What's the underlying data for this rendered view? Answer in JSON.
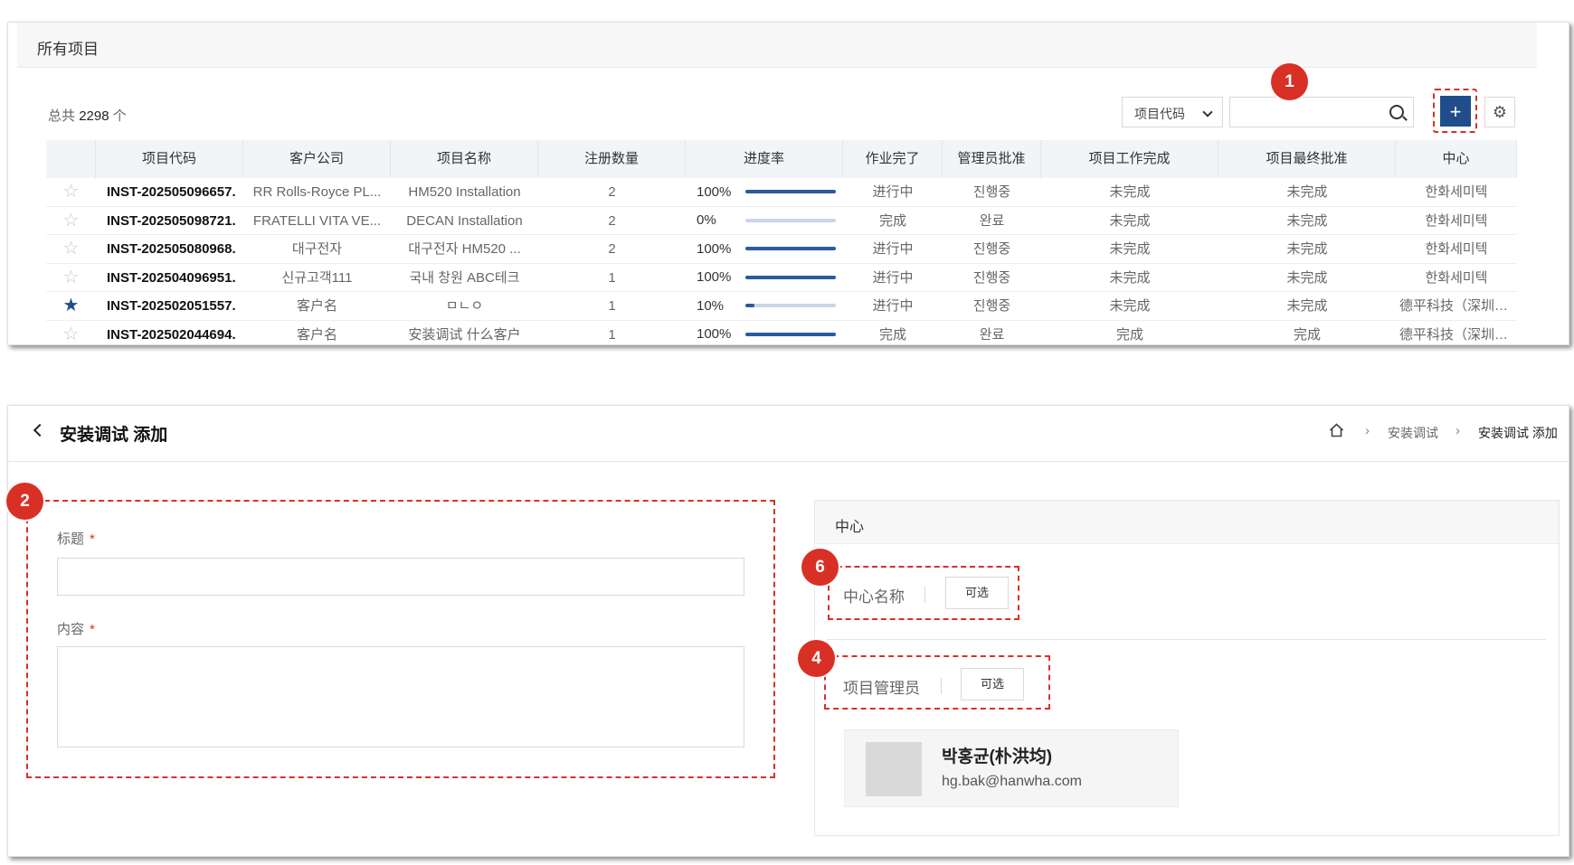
{
  "all_projects": {
    "title": "所有项目",
    "total_prefix": "总共",
    "total_count": "2298",
    "total_suffix": "个",
    "filter_value": "项目代码",
    "search_value": "",
    "add_label": "+",
    "columns": [
      "",
      "项目代码",
      "客户公司",
      "项目名称",
      "注册数量",
      "进度率",
      "作业完了",
      "管理员批准",
      "项目工作完成",
      "项目最终批准",
      "中心"
    ],
    "rows": [
      {
        "starred": false,
        "code": "INST-202505096657.",
        "client": "RR Rolls-Royce PL...",
        "name": "HM520 Installation",
        "qty": "2",
        "progress_text": "100%",
        "progress": 1.0,
        "work": "进行中",
        "admin": "진행중",
        "proj_done": "未完成",
        "final": "未完成",
        "center": "한화세미텍"
      },
      {
        "starred": false,
        "code": "INST-202505098721.",
        "client": "FRATELLI VITA VE...",
        "name": "DECAN Installation",
        "qty": "2",
        "progress_text": "0%",
        "progress": 0.0,
        "work": "完成",
        "admin": "완료",
        "proj_done": "未完成",
        "final": "未完成",
        "center": "한화세미텍"
      },
      {
        "starred": false,
        "code": "INST-202505080968.",
        "client": "대구전자",
        "name": "대구전자 HM520 ...",
        "qty": "2",
        "progress_text": "100%",
        "progress": 1.0,
        "work": "进行中",
        "admin": "진행중",
        "proj_done": "未完成",
        "final": "未完成",
        "center": "한화세미텍"
      },
      {
        "starred": false,
        "code": "INST-202504096951.",
        "client": "신규고객111",
        "name": "국내 창원 ABC테크",
        "qty": "1",
        "progress_text": "100%",
        "progress": 1.0,
        "work": "进行中",
        "admin": "진행중",
        "proj_done": "未完成",
        "final": "未完成",
        "center": "한화세미텍"
      },
      {
        "starred": true,
        "code": "INST-202502051557.",
        "client": "客户名",
        "name": "ㅁㄴㅇ",
        "qty": "1",
        "progress_text": "10%",
        "progress": 0.1,
        "work": "进行中",
        "admin": "진행중",
        "proj_done": "未完成",
        "final": "未完成",
        "center": "德平科技（深圳）有"
      },
      {
        "starred": false,
        "code": "INST-202502044694.",
        "client": "客户名",
        "name": "安装调试 什么客户",
        "qty": "1",
        "progress_text": "100%",
        "progress": 1.0,
        "work": "完成",
        "admin": "완료",
        "proj_done": "完成",
        "final": "完成",
        "center": "德平科技（深圳）有"
      }
    ]
  },
  "add_page": {
    "title": "安装调试 添加",
    "breadcrumb": [
      "安装调试",
      "安装调试 添加"
    ],
    "breadcrumb_sep": "›",
    "form": {
      "title_label": "标题",
      "content_label": "内容",
      "required_mark": "*",
      "title_value": "",
      "content_value": ""
    },
    "center": {
      "header": "中心",
      "center_name_label": "中心名称",
      "manager_label": "项目管理员",
      "select_label": "可选",
      "manager_name": "박홍균(朴洪均)",
      "manager_email": "hg.bak@hanwha.com"
    }
  },
  "annotations": [
    "1",
    "2",
    "6",
    "4"
  ],
  "colors": {
    "accent": "#1f4e8a",
    "annotation": "#d93025",
    "progress_fill": "#2c5aa0",
    "progress_track": "#c9d6e8"
  }
}
